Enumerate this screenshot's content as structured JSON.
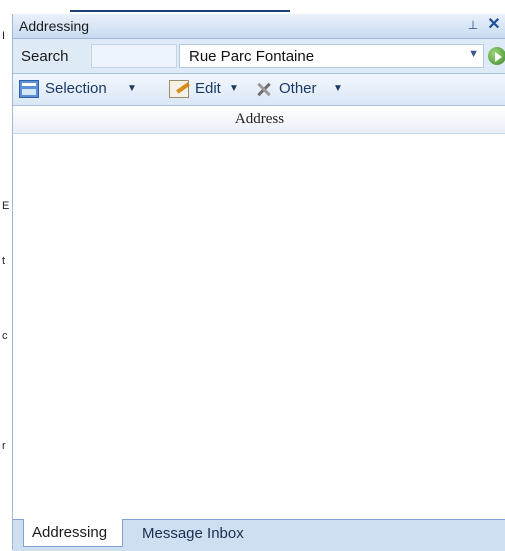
{
  "panel": {
    "title": "Addressing",
    "pin_glyph": "⊥",
    "close_glyph": "✕"
  },
  "search": {
    "label": "Search",
    "value": "",
    "street_value": "Rue Parc Fontaine",
    "combo_arrow": "▼",
    "go_icon": "go-arrow-icon"
  },
  "toolbar": {
    "items": [
      {
        "label": "Selection",
        "icon": "selection-icon",
        "arrow": "▼"
      },
      {
        "label": "Edit",
        "icon": "edit-icon",
        "arrow": "▼"
      },
      {
        "label": "Other",
        "icon": "tools-icon",
        "arrow": "▼"
      }
    ]
  },
  "grid": {
    "columns": [
      "Address"
    ],
    "rows": []
  },
  "tabs": [
    {
      "label": "Addressing",
      "active": true
    },
    {
      "label": "Message Inbox",
      "active": false
    }
  ],
  "colors": {
    "panel_header": "#c9dbf1",
    "toolbar_bg": "#dbe7f6",
    "tab_strip": "#cfdff2",
    "accent": "#1f4f96"
  }
}
